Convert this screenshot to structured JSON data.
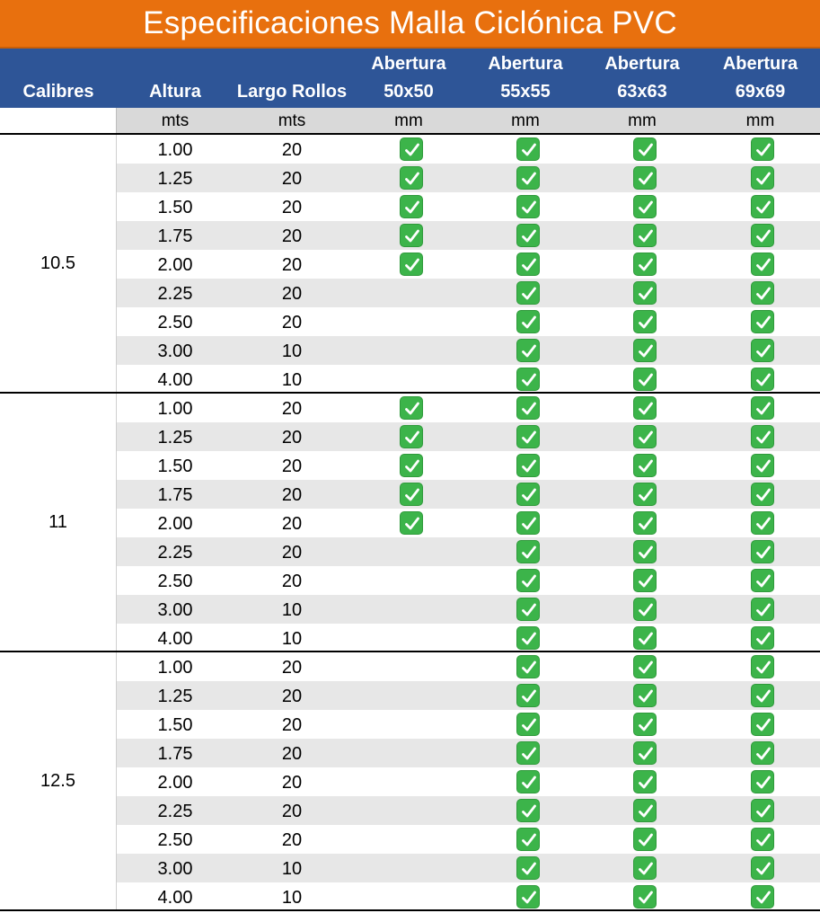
{
  "title": "Especificaciones Malla Ciclónica PVC",
  "header": {
    "calibres": "Calibres",
    "altura": "Altura",
    "largo": "Largo Rollos",
    "aberturas": [
      {
        "line1": "Abertura",
        "line2": "50x50"
      },
      {
        "line1": "Abertura",
        "line2": "55x55"
      },
      {
        "line1": "Abertura",
        "line2": "63x63"
      },
      {
        "line1": "Abertura",
        "line2": "69x69"
      }
    ]
  },
  "units": {
    "altura": "mts",
    "largo": "mts",
    "aberturas": [
      "mm",
      "mm",
      "mm",
      "mm"
    ]
  },
  "colors": {
    "title_bg": "#e8700e",
    "header_bg": "#2e5597",
    "check": "#3cb44a",
    "row_alt": "#e7e7e7"
  },
  "check_icon": "white-check-mark-icon",
  "groups": [
    {
      "calibre": "10.5",
      "rows": [
        {
          "altura": "1.00",
          "largo": "20",
          "checks": [
            true,
            true,
            true,
            true
          ]
        },
        {
          "altura": "1.25",
          "largo": "20",
          "checks": [
            true,
            true,
            true,
            true
          ]
        },
        {
          "altura": "1.50",
          "largo": "20",
          "checks": [
            true,
            true,
            true,
            true
          ]
        },
        {
          "altura": "1.75",
          "largo": "20",
          "checks": [
            true,
            true,
            true,
            true
          ]
        },
        {
          "altura": "2.00",
          "largo": "20",
          "checks": [
            true,
            true,
            true,
            true
          ]
        },
        {
          "altura": "2.25",
          "largo": "20",
          "checks": [
            false,
            true,
            true,
            true
          ]
        },
        {
          "altura": "2.50",
          "largo": "20",
          "checks": [
            false,
            true,
            true,
            true
          ]
        },
        {
          "altura": "3.00",
          "largo": "10",
          "checks": [
            false,
            true,
            true,
            true
          ]
        },
        {
          "altura": "4.00",
          "largo": "10",
          "checks": [
            false,
            true,
            true,
            true
          ]
        }
      ]
    },
    {
      "calibre": "11",
      "rows": [
        {
          "altura": "1.00",
          "largo": "20",
          "checks": [
            true,
            true,
            true,
            true
          ]
        },
        {
          "altura": "1.25",
          "largo": "20",
          "checks": [
            true,
            true,
            true,
            true
          ]
        },
        {
          "altura": "1.50",
          "largo": "20",
          "checks": [
            true,
            true,
            true,
            true
          ]
        },
        {
          "altura": "1.75",
          "largo": "20",
          "checks": [
            true,
            true,
            true,
            true
          ]
        },
        {
          "altura": "2.00",
          "largo": "20",
          "checks": [
            true,
            true,
            true,
            true
          ]
        },
        {
          "altura": "2.25",
          "largo": "20",
          "checks": [
            false,
            true,
            true,
            true
          ]
        },
        {
          "altura": "2.50",
          "largo": "20",
          "checks": [
            false,
            true,
            true,
            true
          ]
        },
        {
          "altura": "3.00",
          "largo": "10",
          "checks": [
            false,
            true,
            true,
            true
          ]
        },
        {
          "altura": "4.00",
          "largo": "10",
          "checks": [
            false,
            true,
            true,
            true
          ]
        }
      ]
    },
    {
      "calibre": "12.5",
      "rows": [
        {
          "altura": "1.00",
          "largo": "20",
          "checks": [
            false,
            true,
            true,
            true
          ]
        },
        {
          "altura": "1.25",
          "largo": "20",
          "checks": [
            false,
            true,
            true,
            true
          ]
        },
        {
          "altura": "1.50",
          "largo": "20",
          "checks": [
            false,
            true,
            true,
            true
          ]
        },
        {
          "altura": "1.75",
          "largo": "20",
          "checks": [
            false,
            true,
            true,
            true
          ]
        },
        {
          "altura": "2.00",
          "largo": "20",
          "checks": [
            false,
            true,
            true,
            true
          ]
        },
        {
          "altura": "2.25",
          "largo": "20",
          "checks": [
            false,
            true,
            true,
            true
          ]
        },
        {
          "altura": "2.50",
          "largo": "20",
          "checks": [
            false,
            true,
            true,
            true
          ]
        },
        {
          "altura": "3.00",
          "largo": "10",
          "checks": [
            false,
            true,
            true,
            true
          ]
        },
        {
          "altura": "4.00",
          "largo": "10",
          "checks": [
            false,
            true,
            true,
            true
          ]
        }
      ]
    }
  ]
}
